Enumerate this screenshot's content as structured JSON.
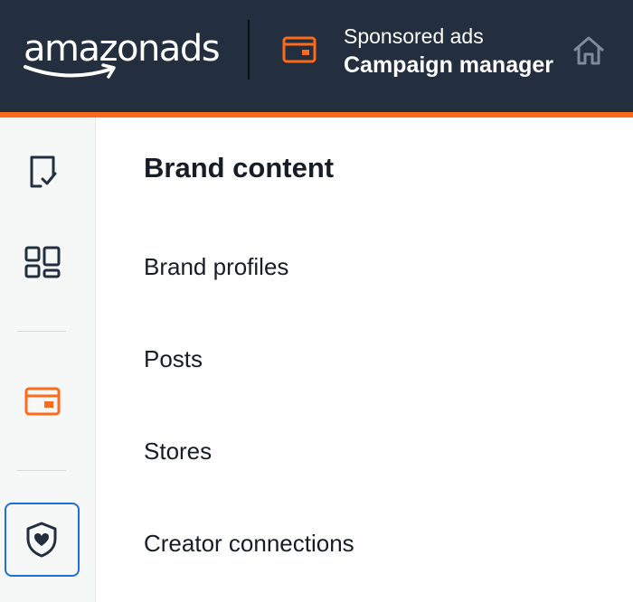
{
  "header": {
    "logo_text": "amazonads",
    "app_subtitle": "Sponsored ads",
    "app_title": "Campaign manager",
    "app_icon": "campaign-card-icon",
    "home_icon": "home-icon"
  },
  "colors": {
    "header_bg": "#232f3e",
    "accent": "#ff6a1a",
    "selected_outline": "#1e6fd9",
    "text": "#161d26",
    "sidebar_bg": "#f6f7f7"
  },
  "sidebar": {
    "items": [
      {
        "icon": "task-checklist-icon"
      },
      {
        "icon": "dashboard-grid-icon"
      },
      {
        "icon": "campaign-card-icon",
        "active": true
      },
      {
        "icon": "shield-heart-icon",
        "selected": true
      }
    ]
  },
  "main": {
    "section_title": "Brand content",
    "links": [
      {
        "label": "Brand profiles"
      },
      {
        "label": "Posts"
      },
      {
        "label": "Stores"
      },
      {
        "label": "Creator connections"
      }
    ]
  }
}
